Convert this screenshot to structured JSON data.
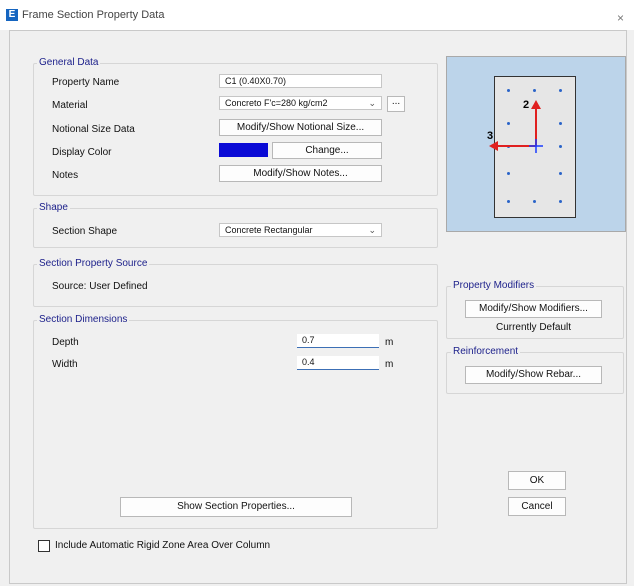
{
  "window": {
    "icon_letter": "E",
    "title": "Frame Section Property Data",
    "close_symbol": "×"
  },
  "general_data": {
    "legend": "General Data",
    "property_name": {
      "label": "Property Name",
      "value": "C1 (0.40X0.70)"
    },
    "material": {
      "label": "Material",
      "value": "Concreto F'c=280 kg/cm2",
      "browse_label": "..."
    },
    "notional_size": {
      "label": "Notional Size Data",
      "button": "Modify/Show Notional Size..."
    },
    "display_color": {
      "label": "Display Color",
      "color": "#0a0ad6",
      "button": "Change..."
    },
    "notes": {
      "label": "Notes",
      "button": "Modify/Show Notes..."
    }
  },
  "shape": {
    "legend": "Shape",
    "label": "Section Shape",
    "value": "Concrete Rectangular"
  },
  "property_source": {
    "legend": "Section Property Source",
    "source_text": "Source:  User Defined"
  },
  "dimensions": {
    "legend": "Section Dimensions",
    "depth": {
      "label": "Depth",
      "value": "0.7",
      "unit": "m"
    },
    "width": {
      "label": "Width",
      "value": "0.4",
      "unit": "m"
    },
    "show_properties_button": "Show Section Properties..."
  },
  "preview": {
    "axis_2_label": "2",
    "axis_3_label": "3",
    "axis_2_color": "#e02020",
    "axis_3_color": "#e02020"
  },
  "property_modifiers": {
    "legend": "Property Modifiers",
    "button": "Modify/Show Modifiers...",
    "status": "Currently Default"
  },
  "reinforcement": {
    "legend": "Reinforcement",
    "button": "Modify/Show Rebar..."
  },
  "actions": {
    "ok": "OK",
    "cancel": "Cancel"
  },
  "rigid_zone": {
    "label": "Include Automatic Rigid Zone Area Over Column",
    "checked": false
  }
}
